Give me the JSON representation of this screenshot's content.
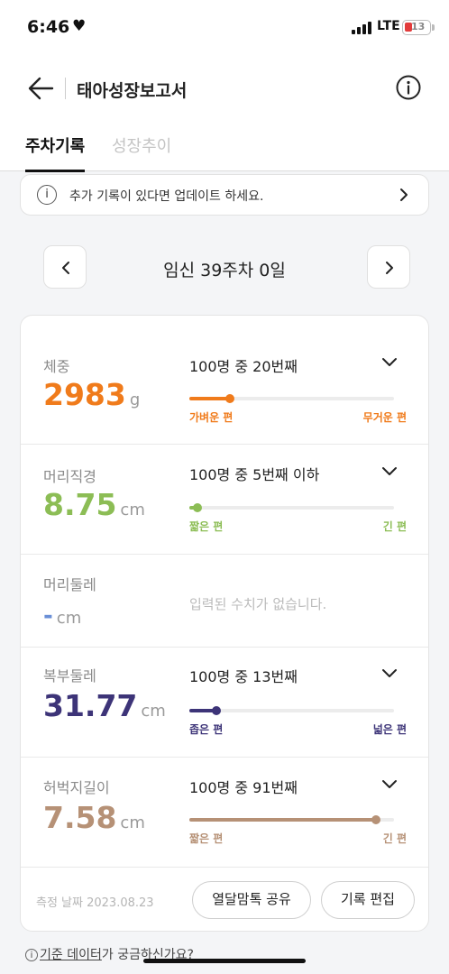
{
  "status": {
    "time": "6:46",
    "network": "LTE",
    "battery": "13"
  },
  "header": {
    "title": "태아성장보고서"
  },
  "tabs": [
    {
      "label": "주차기록",
      "active": true
    },
    {
      "label": "성장추이",
      "active": false
    }
  ],
  "notice": {
    "text": "추가 기록이 있다면 업데이트 하세요."
  },
  "week": {
    "label": "임신 39주차 0일"
  },
  "metrics": [
    {
      "label": "체중",
      "value": "2983",
      "unit": "g",
      "rank": "100명 중 20번째",
      "percentile": 20,
      "scale_left": "가벼운 편",
      "scale_right": "무거운 편",
      "color": "#f07b1b"
    },
    {
      "label": "머리직경",
      "value": "8.75",
      "unit": "cm",
      "rank": "100명 중 5번째 이하",
      "percentile": 4,
      "scale_left": "짧은 편",
      "scale_right": "긴 편",
      "color": "#8cbd55"
    },
    {
      "label": "머리둘레",
      "value": "-",
      "unit": "cm",
      "empty_text": "입력된 수치가 없습니다.",
      "color": "#6a8fd6"
    },
    {
      "label": "복부둘레",
      "value": "31.77",
      "unit": "cm",
      "rank": "100명 중 13번째",
      "percentile": 13,
      "scale_left": "좁은 편",
      "scale_right": "넓은 편",
      "color": "#3d3478"
    },
    {
      "label": "허벅지길이",
      "value": "7.58",
      "unit": "cm",
      "rank": "100명 중 91번째",
      "percentile": 91,
      "scale_left": "짧은 편",
      "scale_right": "긴 편",
      "color": "#b69176"
    }
  ],
  "footer": {
    "measure_date": "측정 날짜 2023.08.23",
    "share_label": "열달맘톡 공유",
    "edit_label": "기록 편집",
    "data_link_underlined": "기준 데이터",
    "data_link_rest": "가 궁금하신가요?"
  }
}
